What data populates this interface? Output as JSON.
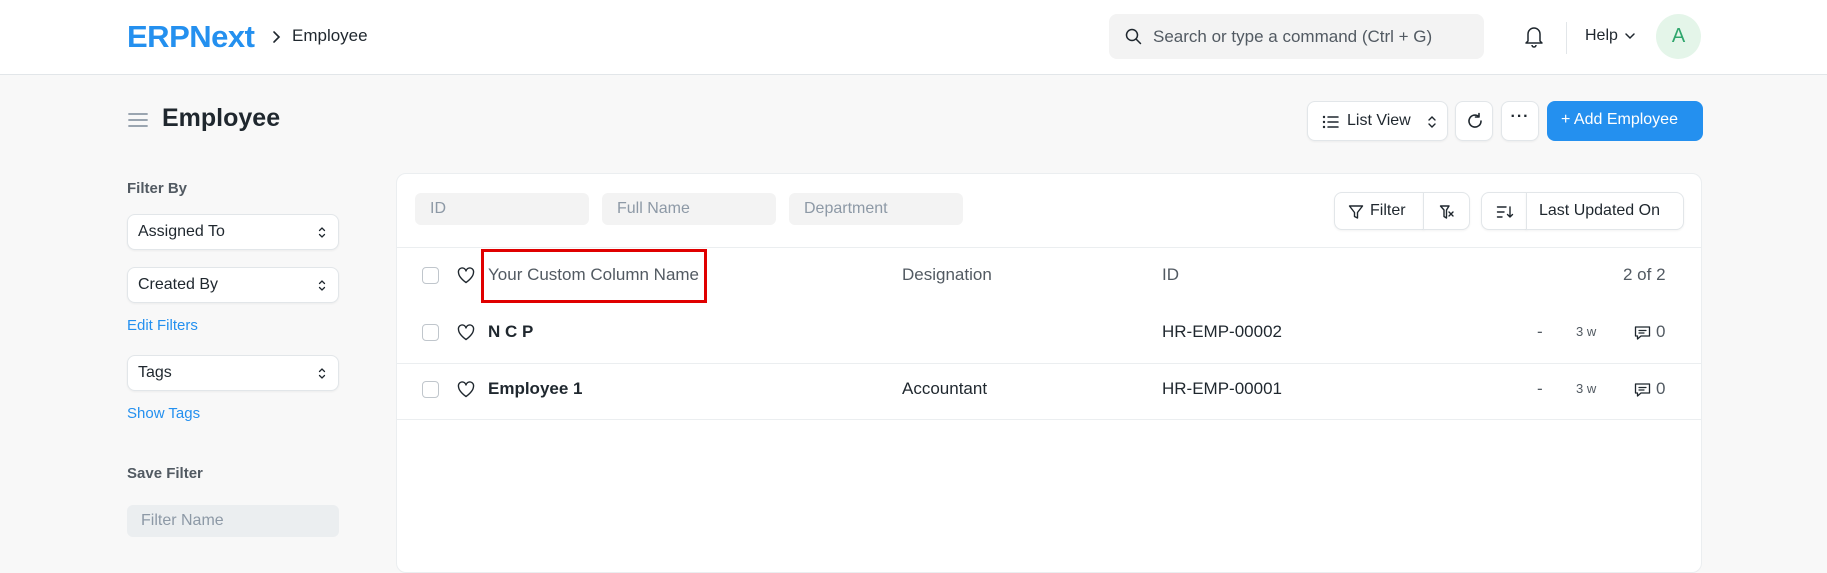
{
  "navbar": {
    "logo": "ERPNext",
    "breadcrumb": "Employee",
    "search_placeholder": "Search or type a command (Ctrl + G)",
    "help_label": "Help",
    "avatar_initial": "A"
  },
  "page": {
    "title": "Employee",
    "list_view_label": "List View",
    "more_label": "···",
    "add_button_label": "+ Add Employee"
  },
  "sidebar": {
    "filter_by_heading": "Filter By",
    "assigned_to_label": "Assigned To",
    "created_by_label": "Created By",
    "edit_filters_label": "Edit Filters",
    "tags_label": "Tags",
    "show_tags_label": "Show Tags",
    "save_filter_heading": "Save Filter",
    "filter_name_placeholder": "Filter Name"
  },
  "filters": {
    "id_placeholder": "ID",
    "full_name_placeholder": "Full Name",
    "department_placeholder": "Department",
    "filter_label": "Filter",
    "sort_label": "Last Updated On"
  },
  "table": {
    "headers": {
      "name": "Your Custom Column Name",
      "designation": "Designation",
      "id": "ID",
      "count": "2 of 2"
    },
    "rows": [
      {
        "name": "N C P",
        "designation": "",
        "id": "HR-EMP-00002",
        "dash": "-",
        "modified": "3 w",
        "comments": "0"
      },
      {
        "name": "Employee 1",
        "designation": "Accountant",
        "id": "HR-EMP-00001",
        "dash": "-",
        "modified": "3 w",
        "comments": "0"
      }
    ]
  },
  "colors": {
    "primary": "#2490ef",
    "highlight": "#e00000",
    "avatar_bg": "#e4f5e9",
    "avatar_text": "#30a66d"
  },
  "icons": [
    "search-icon",
    "bell-icon",
    "chevron-down-icon",
    "menu-icon",
    "list-icon",
    "sort-icon",
    "refresh-icon",
    "filter-icon",
    "filter-clear-icon",
    "sort-direction-icon",
    "heart-icon",
    "comment-icon",
    "chevron-right-icon"
  ]
}
